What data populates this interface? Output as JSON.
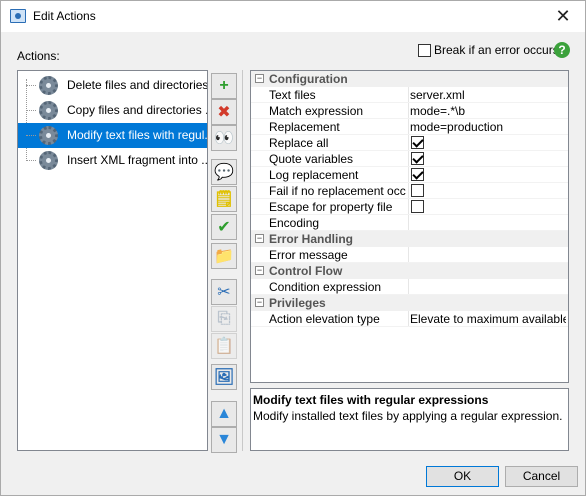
{
  "window": {
    "title": "Edit Actions"
  },
  "actions_label": "Actions:",
  "break_checkbox": {
    "label": "Break if an error occurs",
    "checked": false
  },
  "action_list": [
    {
      "label": "Delete files and directories...",
      "selected": false
    },
    {
      "label": "Copy files and directories ...",
      "selected": false
    },
    {
      "label": "Modify text files with regul...",
      "selected": true
    },
    {
      "label": "Insert XML fragment into ...",
      "selected": false
    }
  ],
  "toolbar": [
    {
      "name": "add-action-button",
      "icon": "plus-icon",
      "glyph": "+",
      "color": "#2e9e2e",
      "disabled": false
    },
    {
      "name": "delete-action-button",
      "icon": "delete-x-icon",
      "glyph": "✖",
      "color": "#d23a2a",
      "disabled": false
    },
    {
      "name": "find-action-button",
      "icon": "binoculars-icon",
      "glyph": "👀",
      "color": "#333333",
      "disabled": false
    },
    {
      "name": "comment-button",
      "icon": "comment-icon",
      "glyph": "💬",
      "color": "#e0a800",
      "disabled": false
    },
    {
      "name": "note-button",
      "icon": "sticky-note-icon",
      "glyph": "🗒",
      "color": "#e0c000",
      "disabled": false
    },
    {
      "name": "enable-button",
      "icon": "checkmark-icon",
      "glyph": "✔",
      "color": "#2e9e2e",
      "disabled": false
    },
    {
      "name": "folder-button",
      "icon": "folder-icon",
      "glyph": "📁",
      "color": "#d8a430",
      "disabled": false
    },
    {
      "name": "cut-button",
      "icon": "scissors-icon",
      "glyph": "✂",
      "color": "#2a6db5",
      "disabled": false
    },
    {
      "name": "copy-button",
      "icon": "copy-icon",
      "glyph": "⎘",
      "color": "#7b8ea3",
      "disabled": true
    },
    {
      "name": "paste-button",
      "icon": "paste-icon",
      "glyph": "📋",
      "color": "#7b8ea3",
      "disabled": true
    },
    {
      "name": "image-button",
      "icon": "image-icon",
      "glyph": "🖼",
      "color": "#2a6db5",
      "disabled": false
    },
    {
      "name": "move-up-button",
      "icon": "arrow-up-icon",
      "glyph": "▲",
      "color": "#2a86d8",
      "disabled": false
    },
    {
      "name": "move-down-button",
      "icon": "arrow-down-icon",
      "glyph": "▼",
      "color": "#2a86d8",
      "disabled": false
    }
  ],
  "properties": [
    {
      "type": "section",
      "label": "Configuration"
    },
    {
      "type": "text",
      "name": "Text files",
      "value": "server.xml"
    },
    {
      "type": "text",
      "name": "Match expression",
      "value": "mode=.*\\b"
    },
    {
      "type": "text",
      "name": "Replacement",
      "value": "mode=production"
    },
    {
      "type": "checkbox",
      "name": "Replace all",
      "checked": true
    },
    {
      "type": "checkbox",
      "name": "Quote variables",
      "checked": true
    },
    {
      "type": "checkbox",
      "name": "Log replacement",
      "checked": true
    },
    {
      "type": "checkbox",
      "name": "Fail if no replacement occ...",
      "checked": false
    },
    {
      "type": "checkbox",
      "name": "Escape for property file",
      "checked": false
    },
    {
      "type": "text",
      "name": "Encoding",
      "value": ""
    },
    {
      "type": "section",
      "label": "Error Handling"
    },
    {
      "type": "text",
      "name": "Error message",
      "value": ""
    },
    {
      "type": "section",
      "label": "Control Flow"
    },
    {
      "type": "text",
      "name": "Condition expression",
      "value": ""
    },
    {
      "type": "section",
      "label": "Privileges"
    },
    {
      "type": "text",
      "name": "Action elevation type",
      "value": "Elevate to maximum available..."
    }
  ],
  "description": {
    "title": "Modify text files with regular expressions",
    "text": "Modify installed text files by applying a regular expression."
  },
  "buttons": {
    "ok": "OK",
    "cancel": "Cancel"
  }
}
